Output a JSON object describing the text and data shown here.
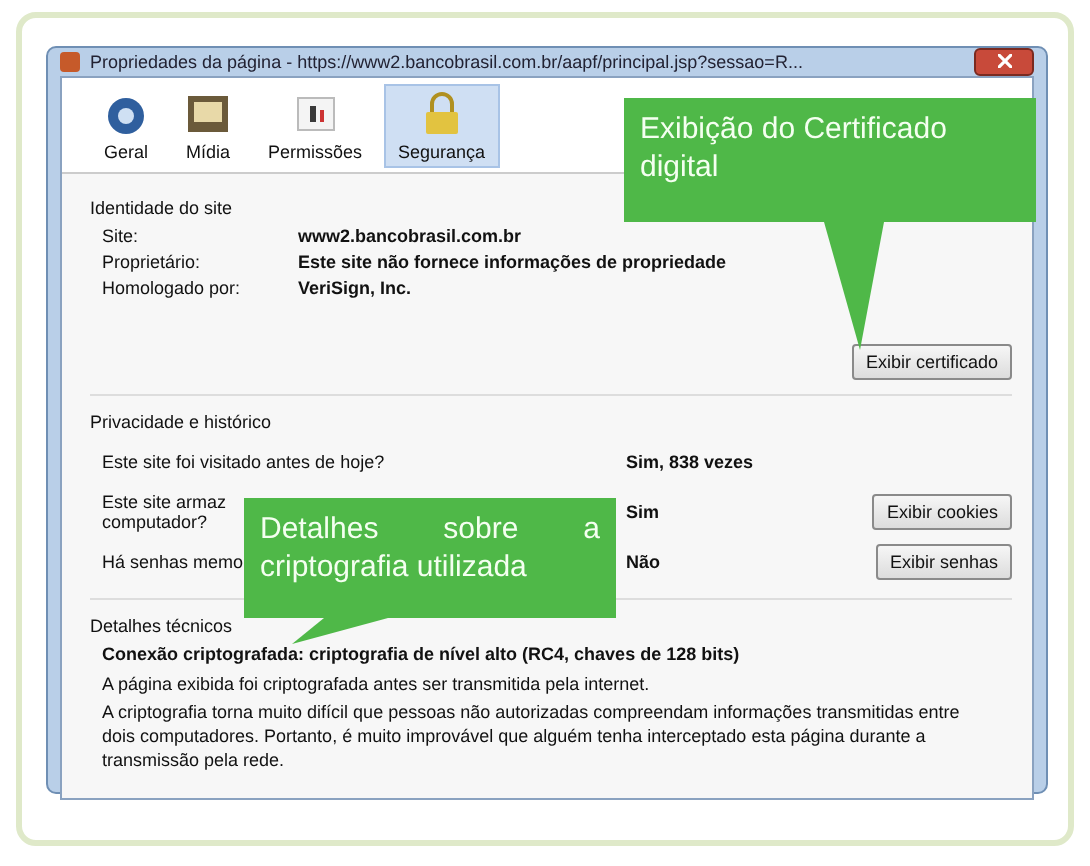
{
  "window": {
    "title": "Propriedades da página - https://www2.bancobrasil.com.br/aapf/principal.jsp?sessao=R..."
  },
  "tabs": [
    {
      "label": "Geral",
      "selected": false
    },
    {
      "label": "Mídia",
      "selected": false
    },
    {
      "label": "Permissões",
      "selected": false
    },
    {
      "label": "Segurança",
      "selected": true
    }
  ],
  "identity": {
    "heading": "Identidade do site",
    "fields": [
      {
        "label": "Site:",
        "value": "www2.bancobrasil.com.br"
      },
      {
        "label": "Proprietário:",
        "value": "Este site não fornece informações de propriedade"
      },
      {
        "label": "Homologado por:",
        "value": "VeriSign, Inc."
      }
    ],
    "button": "Exibir certificado"
  },
  "privacy": {
    "heading": "Privacidade e histórico",
    "rows": [
      {
        "question": [
          "Este site foi visitado antes de hoje?"
        ],
        "answer": "Sim, 838 vezes"
      },
      {
        "question": [
          "Este site armaz",
          "computador?"
        ],
        "answer": "Sim",
        "button": "Exibir cookies"
      },
      {
        "question": [
          "Há senhas memo"
        ],
        "answer": "Não",
        "button": "Exibir senhas"
      }
    ]
  },
  "technical": {
    "heading": "Detalhes técnicos",
    "lines": [
      {
        "text": "Conexão criptografada: criptografia de nível alto (RC4, chaves de 128 bits)",
        "bold": true
      },
      {
        "text": "A página exibida foi criptografada antes ser transmitida pela internet.",
        "bold": false
      },
      {
        "text": "A criptografia torna muito difícil que pessoas não autorizadas compreendam informações transmitidas entre dois computadores. Portanto, é muito improvável que alguém tenha interceptado esta página durante a transmissão pela rede.",
        "bold": false
      }
    ]
  },
  "callouts": [
    {
      "text": "Exibição do Certificado digital"
    },
    {
      "text": "Detalhes sobre a criptografia utilizada"
    }
  ]
}
